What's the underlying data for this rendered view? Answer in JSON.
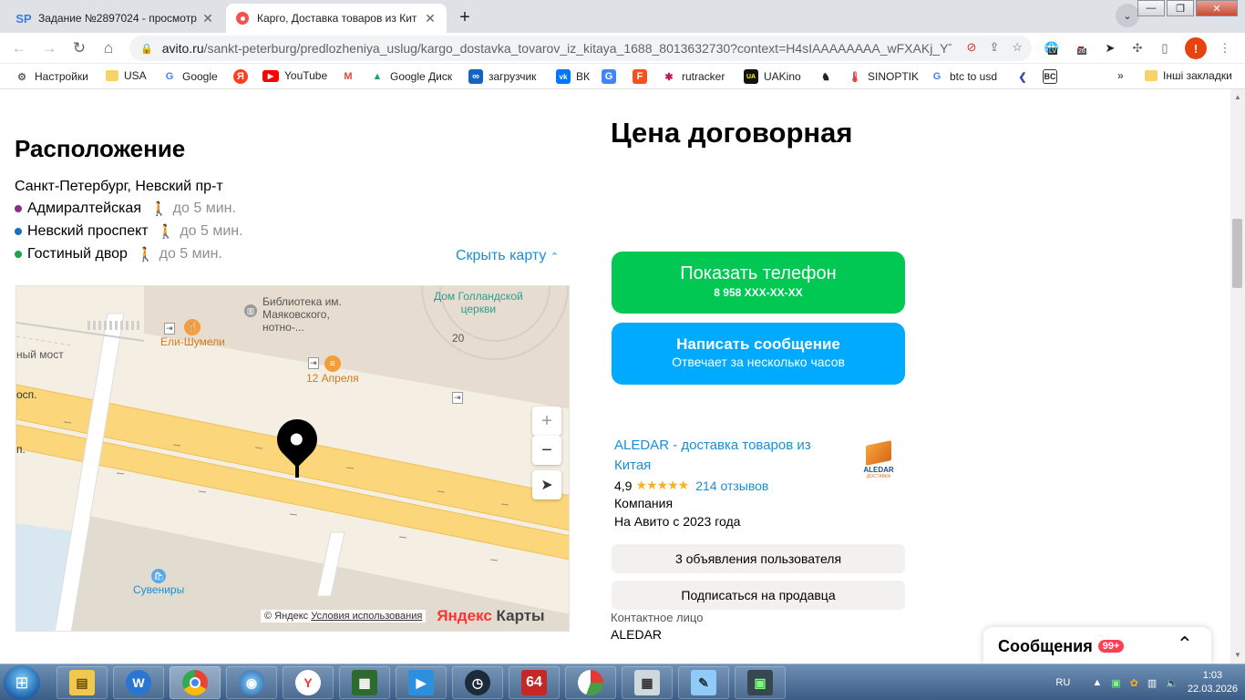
{
  "browser": {
    "tabs": [
      {
        "favicon": "SP",
        "title": "Задание №2897024 - просмотр",
        "active": false
      },
      {
        "favicon": "avito-icon",
        "title": "Карго, Доставка товаров из Кит",
        "active": true
      }
    ],
    "url_host": "avito.ru",
    "url_path": "/sankt-peterburg/predlozheniya_uslug/kargo_dostavka_tovarov_iz_kitaya_1688_8013632730?context=H4sIAAAAAAAA_wFXAKj_YT...",
    "profile_initial": "!",
    "ext_badge": "26",
    "ext_lv": "LV",
    "bookmarks": [
      {
        "icon": "gear-icon",
        "label": "Настройки"
      },
      {
        "icon": "folder-icon",
        "label": "USA"
      },
      {
        "icon": "google-icon",
        "label": "Google"
      },
      {
        "icon": "yandex-icon",
        "label": ""
      },
      {
        "icon": "youtube-icon",
        "label": "YouTube"
      },
      {
        "icon": "gmail-icon",
        "label": ""
      },
      {
        "icon": "drive-icon",
        "label": "Google Диск"
      },
      {
        "icon": "link-icon",
        "label": "загрузчик"
      },
      {
        "icon": "vk-icon",
        "label": "ВК"
      },
      {
        "icon": "translate-icon",
        "label": ""
      },
      {
        "icon": "f-icon",
        "label": ""
      },
      {
        "icon": "rutracker-icon",
        "label": "rutracker"
      },
      {
        "icon": "uakino-icon",
        "label": "UAKino"
      },
      {
        "icon": "chess-icon",
        "label": ""
      },
      {
        "icon": "thermometer-icon",
        "label": "SINOPTIK"
      },
      {
        "icon": "google-icon",
        "label": "btc to usd"
      },
      {
        "icon": "arrow-icon",
        "label": ""
      },
      {
        "icon": "bc-icon",
        "label": "BC"
      },
      {
        "icon": "more-icon",
        "label": "»"
      },
      {
        "icon": "folder-icon",
        "label": "Інші закладки"
      }
    ]
  },
  "listing": {
    "location_title": "Расположение",
    "address": "Санкт-Петербург, Невский пр-т",
    "metro": [
      {
        "name": "Адмиралтейская",
        "color": "#8b2c8f",
        "time": "до 5 мин."
      },
      {
        "name": "Невский проспект",
        "color": "#1f6fbf",
        "time": "до 5 мин."
      },
      {
        "name": "Гостиный двор",
        "color": "#1aa34a",
        "time": "до 5 мин."
      }
    ],
    "hide_map": "Скрыть карту",
    "price": "Цена договорная",
    "phone_button": "Показать телефон",
    "phone_masked": "8 958 XXX-XX-XX",
    "message_button": "Написать сообщение",
    "message_sub": "Отвечает за несколько часов",
    "seller": {
      "name": "ALEDAR - доставка товаров из Китая",
      "rating": "4,9",
      "stars": "★★★★★",
      "reviews": "214 отзывов",
      "type": "Компания",
      "since": "На Авито с 2023 года",
      "logo_text": "ALEDAR",
      "logo_sub": "ДОСТАВКА"
    },
    "ads_button": "3 объявления пользователя",
    "subscribe_button": "Подписаться на продавца",
    "contact_label": "Контактное лицо",
    "contact_name": "ALEDAR",
    "messages_label": "Сообщения",
    "messages_badge": "99+"
  },
  "map": {
    "labels": {
      "library": "Библиотека им.\nМаяковского,\nнотно-...",
      "church": "Дом Голландской\nцеркви",
      "bridge": "ный мост",
      "house_number": "20",
      "road1": "осп.",
      "road2": "п.",
      "cafe1": "Ели-Шумели",
      "cafe2": "12 Апреля",
      "souvenirs": "Сувениры"
    },
    "copyright": "© Яндекс",
    "terms": "Условия использования",
    "brand_red": "Яндекс",
    "brand": "Карты"
  },
  "taskbar": {
    "lang": "RU",
    "time": "1:03",
    "date": "22.03.2026",
    "apps": [
      "explorer-icon",
      "wm-icon",
      "chrome-icon",
      "network-icon",
      "yandex-browser-icon",
      "media-icon",
      "player-icon",
      "clock-icon",
      "64-icon",
      "chart-icon",
      "calculator-icon",
      "notes-icon",
      "monitor-icon"
    ]
  }
}
